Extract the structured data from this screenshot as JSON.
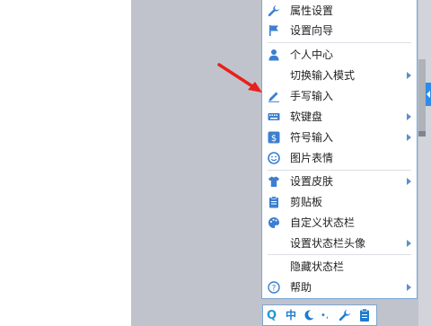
{
  "menu": {
    "items": [
      {
        "label": "属性设置",
        "icon": "wrench-icon"
      },
      {
        "label": "设置向导",
        "icon": "flag-icon"
      },
      {
        "label": "个人中心",
        "icon": "person-icon"
      },
      {
        "label": "切换输入模式",
        "icon": "",
        "submenu": true
      },
      {
        "label": "手写输入",
        "icon": "pencil-icon"
      },
      {
        "label": "软键盘",
        "icon": "keyboard-icon",
        "submenu": true
      },
      {
        "label": "符号输入",
        "icon": "dollar-icon",
        "submenu": true
      },
      {
        "label": "图片表情",
        "icon": "smiley-icon"
      },
      {
        "label": "设置皮肤",
        "icon": "shirt-icon",
        "submenu": true
      },
      {
        "label": "剪贴板",
        "icon": "clipboard-icon"
      },
      {
        "label": "自定义状态栏",
        "icon": "palette-icon"
      },
      {
        "label": "设置状态栏头像",
        "icon": "",
        "submenu": true
      },
      {
        "label": "隐藏状态栏",
        "icon": ""
      },
      {
        "label": "帮助",
        "icon": "help-icon",
        "submenu": true
      }
    ]
  },
  "toolbar": {
    "logo": "Q",
    "mode": "中",
    "punct": "•,",
    "colors": {
      "accent": "#2f8be6",
      "logo": "#1e9ad6",
      "mode": "#1e7bd0"
    }
  }
}
